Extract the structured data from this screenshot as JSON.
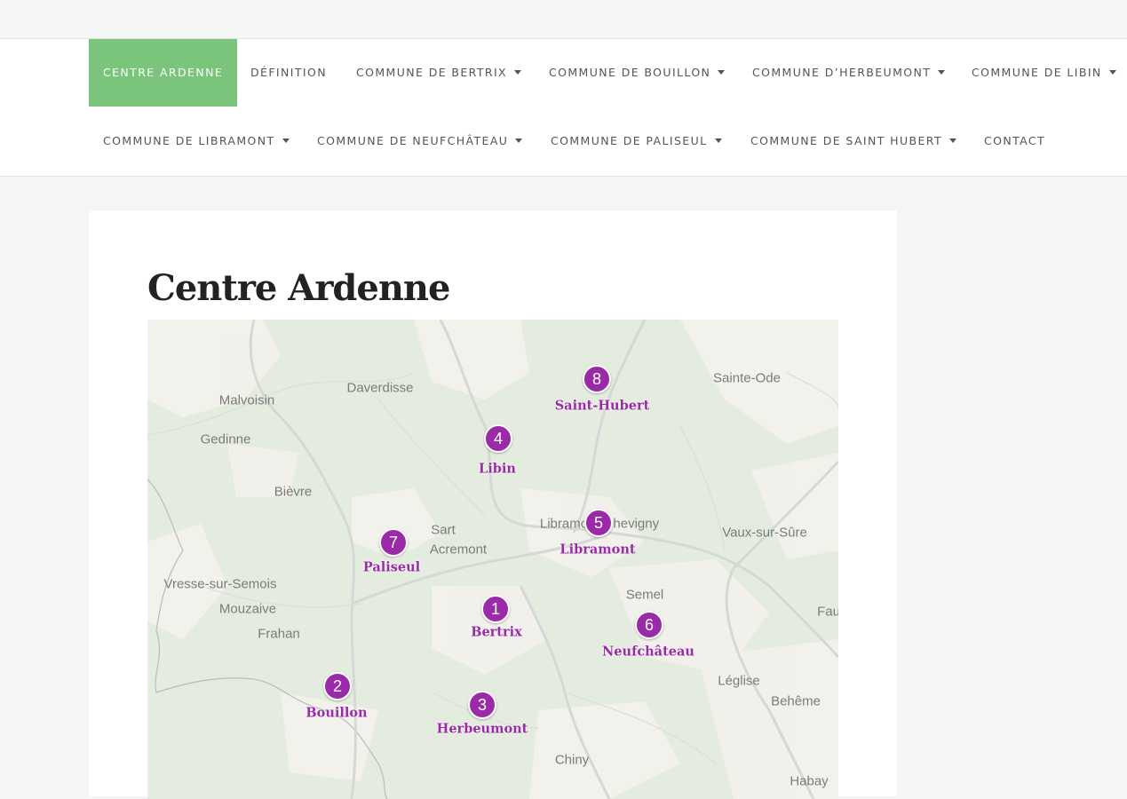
{
  "nav": {
    "row1": [
      {
        "label": "CENTRE ARDENNE",
        "active": true,
        "dropdown": false
      },
      {
        "label": "DÉFINITION",
        "active": false,
        "dropdown": false
      },
      {
        "label": "COMMUNE DE BERTRIX",
        "active": false,
        "dropdown": true
      },
      {
        "label": "COMMUNE DE BOUILLON",
        "active": false,
        "dropdown": true
      },
      {
        "label": "COMMUNE D’HERBEUMONT",
        "active": false,
        "dropdown": true
      },
      {
        "label": "COMMUNE DE LIBIN",
        "active": false,
        "dropdown": true
      }
    ],
    "row2": [
      {
        "label": "COMMUNE DE LIBRAMONT",
        "active": false,
        "dropdown": true
      },
      {
        "label": "COMMUNE DE NEUFCHÂTEAU",
        "active": false,
        "dropdown": true
      },
      {
        "label": "COMMUNE DE PALISEUL",
        "active": false,
        "dropdown": true
      },
      {
        "label": "COMMUNE DE SAINT HUBERT",
        "active": false,
        "dropdown": true
      },
      {
        "label": "CONTACT",
        "active": false,
        "dropdown": false
      }
    ]
  },
  "colors": {
    "accent": "#7ac57b",
    "marker": "#9a2aa8"
  },
  "page": {
    "title": "Centre Ardenne"
  },
  "map": {
    "places": [
      "Malvoisin",
      "Daverdisse",
      "Sainte-Ode",
      "Gedinne",
      "Bièvre",
      "Sart",
      "Acremont",
      "Libramont-Chevigny",
      "Vaux-sur-Sûre",
      "Vresse-sur-Semois",
      "Mouzaive",
      "Frahan",
      "Semel",
      "Fau",
      "Léglise",
      "Behême",
      "Chiny",
      "Habay"
    ],
    "markers": [
      {
        "number": "1",
        "label": "Bertrix"
      },
      {
        "number": "2",
        "label": "Bouillon"
      },
      {
        "number": "3",
        "label": "Herbeumont"
      },
      {
        "number": "4",
        "label": "Libin"
      },
      {
        "number": "5",
        "label": "Libramont"
      },
      {
        "number": "6",
        "label": "Neufchâteau"
      },
      {
        "number": "7",
        "label": "Paliseul"
      },
      {
        "number": "8",
        "label": "Saint-Hubert"
      }
    ]
  }
}
